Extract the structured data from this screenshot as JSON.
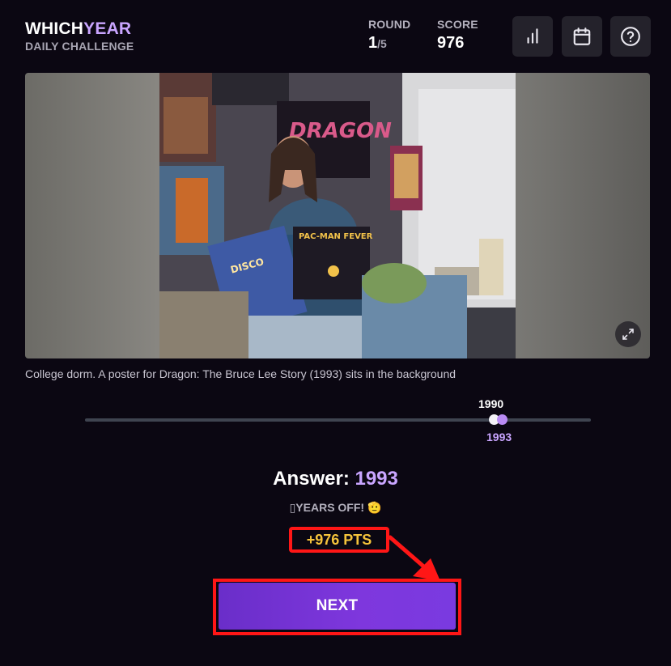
{
  "brand": {
    "title_part1": "WHICH",
    "title_part2": "YEAR",
    "subtitle": "DAILY CHALLENGE"
  },
  "stats": {
    "round_label": "ROUND",
    "round_current": "1",
    "round_total": "/5",
    "score_label": "SCORE",
    "score_value": "976"
  },
  "toolbar": {
    "icons": [
      "bar-chart-icon",
      "calendar-icon",
      "help-icon"
    ]
  },
  "photo": {
    "caption": "College dorm. A poster for Dragon: The Bruce Lee Story (1993) sits in the background",
    "expand_icon": "expand-icon"
  },
  "slider": {
    "guess_year": "1990",
    "answer_year": "1993",
    "guess_position_fraction": 0.805,
    "answer_position_fraction": 0.82
  },
  "result": {
    "answer_label": "Answer:",
    "answer_year": "1993",
    "years_off_text": "YEARS OFF!",
    "years_off_emoji": "🫡",
    "points": "+976 PTS"
  },
  "actions": {
    "next_label": "NEXT"
  },
  "colors": {
    "accent": "#c9a5ff",
    "button": "#7636d8",
    "points": "#f5c33b",
    "annotation": "#ff1616",
    "background": "#0b0712"
  }
}
